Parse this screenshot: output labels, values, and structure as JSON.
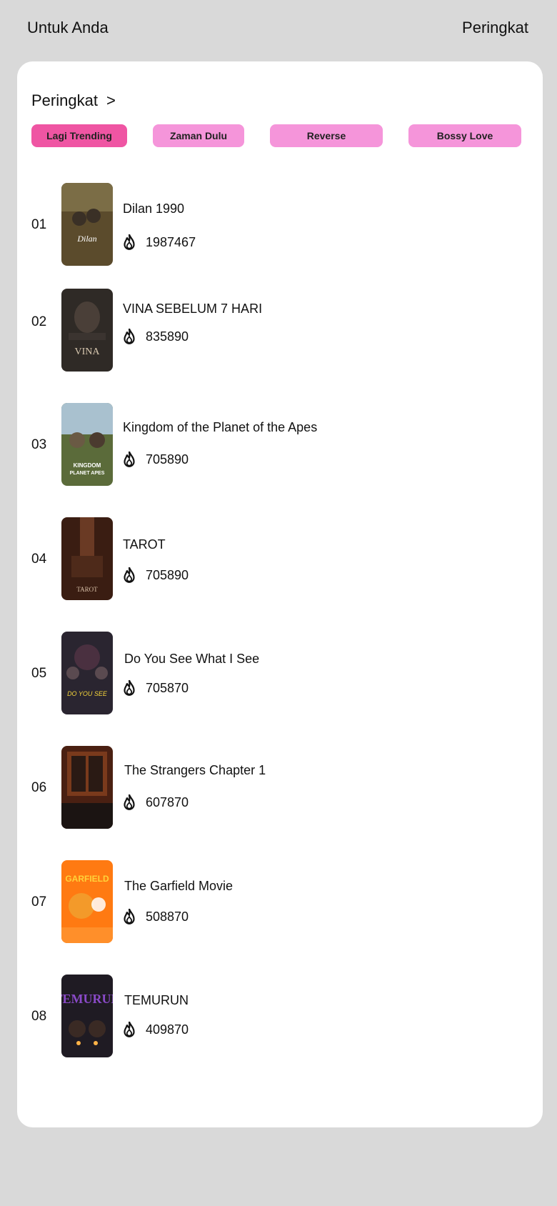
{
  "header": {
    "left_label": "Untuk Anda",
    "right_label": "Peringkat"
  },
  "section": {
    "title": "Peringkat",
    "chevron": ">"
  },
  "tabs": [
    {
      "label": "Lagi Trending",
      "active": true
    },
    {
      "label": "Zaman Dulu",
      "active": false
    },
    {
      "label": "Reverse",
      "active": false
    },
    {
      "label": "Bossy Love",
      "active": false
    }
  ],
  "items": [
    {
      "rank": "01",
      "title": "Dilan 1990",
      "views": "1987467",
      "poster_color": "#5b4b2c"
    },
    {
      "rank": "02",
      "title": "VINA SEBELUM 7 HARI",
      "views": "835890",
      "poster_color": "#2f2a26"
    },
    {
      "rank": "03",
      "title": "Kingdom of the Planet of the Apes",
      "views": "705890",
      "poster_color": "#5b6b3a"
    },
    {
      "rank": "04",
      "title": "TAROT",
      "views": "705890",
      "poster_color": "#3a1d12"
    },
    {
      "rank": "05",
      "title": "Do You See What I See",
      "views": "705870",
      "poster_color": "#2a2530"
    },
    {
      "rank": "06",
      "title": "The Strangers Chapter 1",
      "views": "607870",
      "poster_color": "#4a2012"
    },
    {
      "rank": "07",
      "title": "The Garfield Movie",
      "views": "508870",
      "poster_color": "#ff7a12"
    },
    {
      "rank": "08",
      "title": "TEMURUN",
      "views": "409870",
      "poster_color": "#1f1b23"
    }
  ],
  "colors": {
    "page_bg": "#d9d9d9",
    "card_bg": "#ffffff",
    "chip_active": "#ef55a3",
    "chip_inactive": "#f595da"
  },
  "icons": {
    "views_icon": "flame-icon"
  }
}
